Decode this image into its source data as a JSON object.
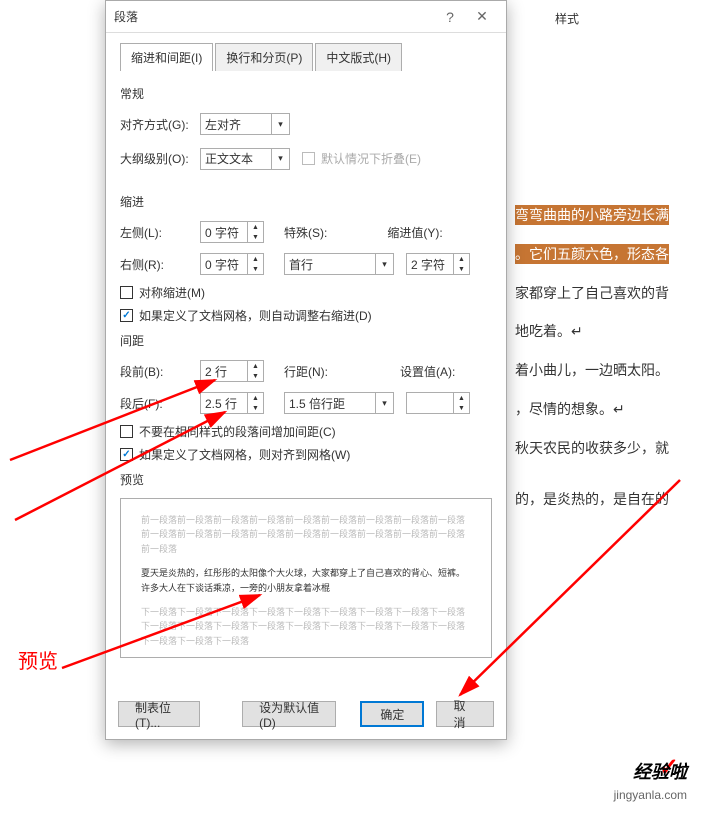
{
  "bg": {
    "highlight1": "弯弯曲曲的小路旁边长满",
    "highlight2": "。它们五颜六色，形态各",
    "line1": "家都穿上了自己喜欢的背",
    "line2": "地吃着。↵",
    "line3": "着小曲儿，一边晒太阳。",
    "line4": "，尽情的想象。↵",
    "line5": "秋天农民的收获多少，就",
    "line6": "的，是炎热的，是自在的",
    "styles_label": "样式"
  },
  "dialog": {
    "title": "段落",
    "tabs": {
      "tab1": "缩进和间距(I)",
      "tab2": "换行和分页(P)",
      "tab3": "中文版式(H)"
    },
    "general": {
      "title": "常规",
      "align_label": "对齐方式(G):",
      "align_value": "左对齐",
      "outline_label": "大纲级别(O):",
      "outline_value": "正文文本",
      "collapse_label": "默认情况下折叠(E)"
    },
    "indent": {
      "title": "缩进",
      "left_label": "左侧(L):",
      "left_value": "0 字符",
      "right_label": "右侧(R):",
      "right_value": "0 字符",
      "special_label": "特殊(S):",
      "special_value": "首行",
      "indent_val_label": "缩进值(Y):",
      "indent_val_value": "2 字符",
      "mirror_label": "对称缩进(M)",
      "auto_adjust_label": "如果定义了文档网格，则自动调整右缩进(D)"
    },
    "spacing": {
      "title": "间距",
      "before_label": "段前(B):",
      "before_value": "2 行",
      "after_label": "段后(F):",
      "after_value": "2.5 行",
      "line_label": "行距(N):",
      "line_value": "1.5 倍行距",
      "setval_label": "设置值(A):",
      "setval_value": "",
      "no_space_label": "不要在相同样式的段落间增加间距(C)",
      "snap_grid_label": "如果定义了文档网格，则对齐到网格(W)"
    },
    "preview": {
      "title": "预览",
      "before_text": "前一段落前一段落前一段落前一段落前一段落前一段落前一段落前一段落前一段落前一段落前一段落前一段落前一段落前一段落前一段落前一段落前一段落前一段落前一段落",
      "main_text": "夏天是炎热的，红彤彤的太阳像个大火球，大家都穿上了自己喜欢的背心、短裤。许多大人在下谈话乘凉，一旁的小朋友拿着冰棍",
      "after_text": "下一段落下一段落下一段落下一段落下一段落下一段落下一段落下一段落下一段落下一段落下一段落下一段落下一段落下一段落下一段落下一段落下一段落下一段落下一段落下一段落下一段落"
    },
    "buttons": {
      "tabs": "制表位(T)...",
      "default": "设为默认值(D)",
      "ok": "确定",
      "cancel": "取消"
    }
  },
  "annotations": {
    "preview_label": "预览",
    "watermark": "jingyanla.com",
    "brand": "经验啦"
  }
}
